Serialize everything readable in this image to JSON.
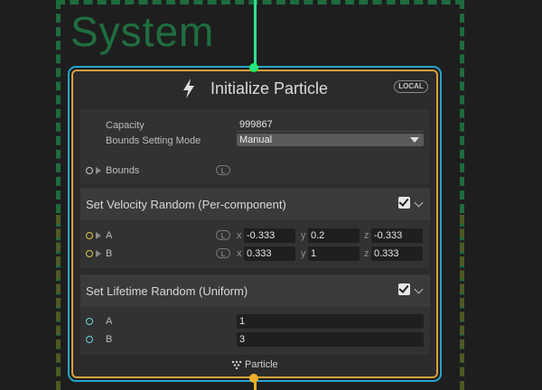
{
  "system": {
    "title": "System"
  },
  "node": {
    "title": "Initialize Particle",
    "badge": "LOCAL",
    "capacity_label": "Capacity",
    "capacity_value": "999867",
    "bounds_mode_label": "Bounds Setting Mode",
    "bounds_mode_value": "Manual",
    "bounds_label": "Bounds",
    "space_badge": "L"
  },
  "blocks": [
    {
      "title": "Set Velocity Random (Per-component)",
      "enabled": true,
      "rows": [
        {
          "label": "A",
          "space": "L",
          "x": "-0.333",
          "y": "0.2",
          "z": "-0.333"
        },
        {
          "label": "B",
          "space": "L",
          "x": "0.333",
          "y": "1",
          "z": "0.333"
        }
      ]
    },
    {
      "title": "Set Lifetime Random (Uniform)",
      "enabled": true,
      "rows": [
        {
          "label": "A",
          "value": "1"
        },
        {
          "label": "B",
          "value": "3"
        }
      ]
    }
  ],
  "axes": {
    "x": "x",
    "y": "y",
    "z": "z"
  },
  "context": {
    "label": "Particle"
  },
  "colors": {
    "flow_in": "#2ee08e",
    "flow_out": "#f0b02a",
    "node_border": "#27a3c9",
    "selection": "#d8a23b"
  }
}
